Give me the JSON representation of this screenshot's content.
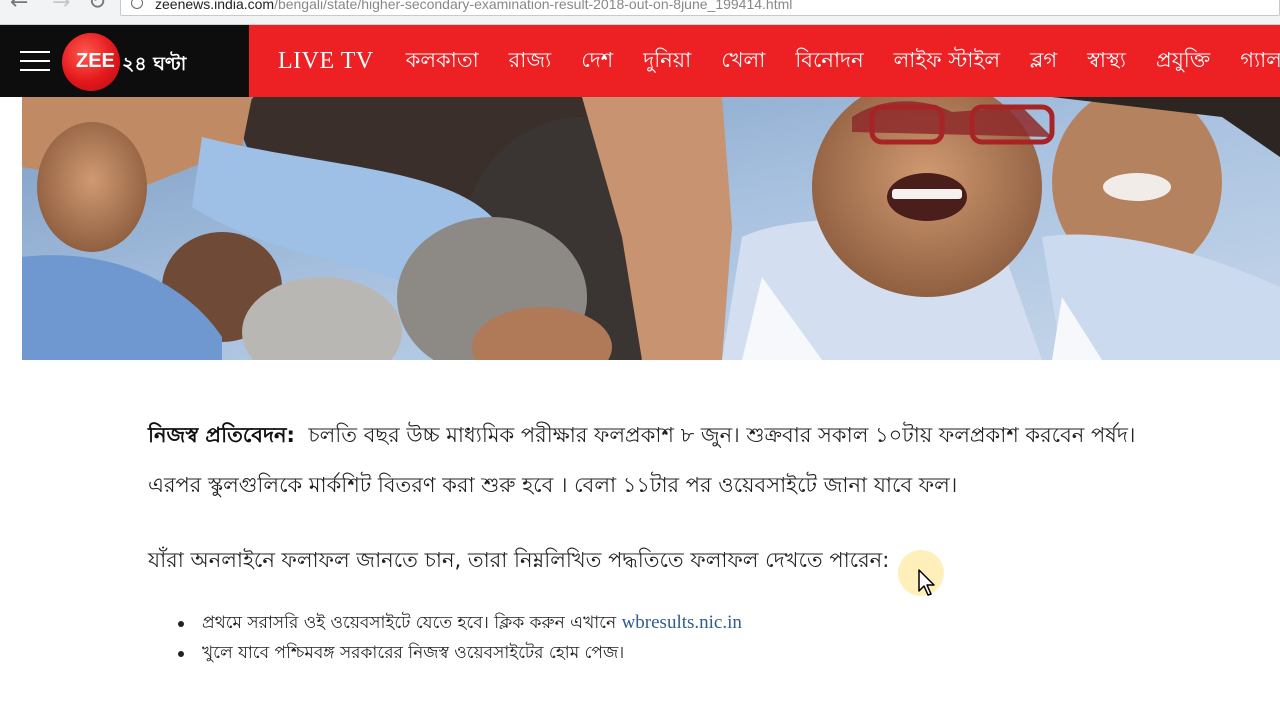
{
  "browser": {
    "url_host": "zeenews.india.com",
    "url_path": "/bengali/state/higher-secondary-examination-result-2018-out-on-8june_199414.html"
  },
  "header": {
    "logo_brand": "ZEE",
    "logo_suffix": "২৪ ঘণ্টা",
    "nav_items": [
      "LIVE TV",
      "কলকাতা",
      "রাজ্য",
      "দেশ",
      "দুনিয়া",
      "খেলা",
      "বিনোদন",
      "লাইফ স্টাইল",
      "ব্লগ",
      "স্বাস্থ্য",
      "প্রযুক্তি",
      "গ্যাল"
    ]
  },
  "article": {
    "lead": "নিজস্ব প্রতিবেদন:",
    "paragraph1": "চলতি বছর উচ্চ মাধ্যমিক পরীক্ষার ফলপ্রকাশ ৮ জুন। শুক্রবার সকাল ১০টায় ফলপ্রকাশ করবেন পর্ষদ।এরপর স্কুলগুলিকে মার্কশিট বিতরণ করা শুরু হবে । বেলা ১১টার পর ওয়েবসাইটে জানা যাবে ফল।",
    "paragraph2": "যাঁরা অনলাইনে ফলাফল জানতে চান, তারা নিম্নলিখিত পদ্ধতিতে ফলাফল দেখতে পারেন:",
    "bullet1_text": "প্রথমে সরাসরি ওই ওয়েবসাইটে যেতে হবে। ক্লিক করুন এখানে",
    "bullet1_link": "wbresults.nic.in",
    "bullet2_text": "খুলে যাবে পশ্চিমবঙ্গ সরকারের নিজস্ব ওয়েবসাইটের হোম পেজ।"
  },
  "colors": {
    "brand_red": "#ed2024",
    "header_black": "#0d0d0d",
    "link_blue": "#2d5d8f"
  }
}
